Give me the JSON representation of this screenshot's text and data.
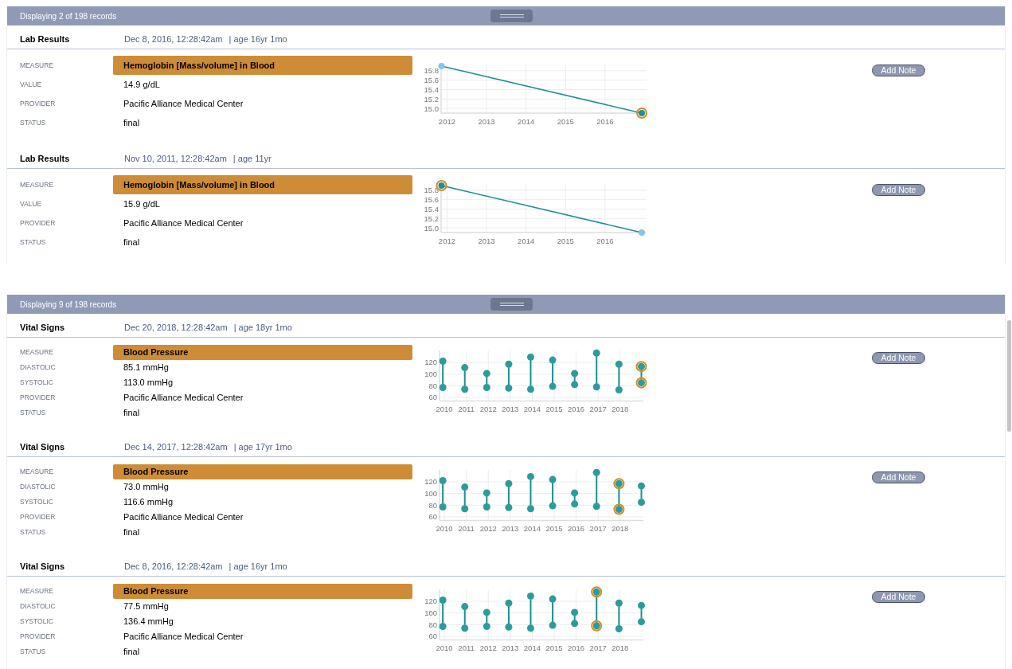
{
  "panels": [
    {
      "record_count": "Displaying 2 of 198 records",
      "records": [
        {
          "category": "Lab Results",
          "date": "Dec 8, 2016, 12:28:42am",
          "age": "| age 16yr 1mo",
          "fields": [
            {
              "kind": "measure",
              "label": "MEASURE",
              "value": "Hemoglobin [Mass/volume] in Blood"
            },
            {
              "kind": "plain",
              "label": "VALUE",
              "value": "14.9 g/dL"
            },
            {
              "kind": "plain",
              "label": "PROVIDER",
              "value": "Pacific Alliance Medical Center"
            },
            {
              "kind": "plain",
              "label": "STATUS",
              "value": "final"
            }
          ],
          "button": "Add Note",
          "chart_data": {
            "type": "line",
            "x": [
              2011.86,
              2016.93
            ],
            "series": [
              {
                "color": "#1f8f95",
                "values": [
                  15.9,
                  14.9
                ]
              },
              {
                "color": "#d98a1e",
                "values": [
                  null,
                  14.9
                ]
              }
            ],
            "marker": "circle",
            "grid": true,
            "xlim": [
              2011.85,
              2017.05
            ],
            "ylim": [
              14.9,
              15.95
            ],
            "xticks": [
              2012,
              2013,
              2014,
              2015,
              2016
            ],
            "yticks": [
              {
                "value": 15,
                "label": "15.0"
              },
              {
                "value": 15.2,
                "label": "15.2"
              },
              {
                "value": 15.4,
                "label": "15.4"
              },
              {
                "value": 15.6,
                "label": "15.6"
              },
              {
                "value": 15.8,
                "label": "15.8"
              }
            ]
          }
        },
        {
          "category": "Lab Results",
          "date": "Nov 10, 2011, 12:28:42am",
          "age": "| age 11yr",
          "fields": [
            {
              "kind": "measure",
              "label": "MEASURE",
              "value": "Hemoglobin [Mass/volume] in Blood"
            },
            {
              "kind": "plain",
              "label": "VALUE",
              "value": "15.9 g/dL"
            },
            {
              "kind": "plain",
              "label": "PROVIDER",
              "value": "Pacific Alliance Medical Center"
            },
            {
              "kind": "plain",
              "label": "STATUS",
              "value": "final"
            }
          ],
          "button": "Add Note",
          "chart_data": {
            "type": "line",
            "x": [
              2011.86,
              2016.93
            ],
            "series": [
              {
                "color": "#1f8f95",
                "values": [
                  15.9,
                  14.9
                ]
              },
              {
                "color": "#d98a1e",
                "values": [
                  15.9,
                  null
                ]
              }
            ],
            "marker": "circle",
            "grid": true,
            "xlim": [
              2011.85,
              2017.05
            ],
            "ylim": [
              14.9,
              15.95
            ],
            "xticks": [
              2012,
              2013,
              2014,
              2015,
              2016
            ],
            "yticks": [
              {
                "value": 15,
                "label": "15.0"
              },
              {
                "value": 15.2,
                "label": "15.2"
              },
              {
                "value": 15.4,
                "label": "15.4"
              },
              {
                "value": 15.6,
                "label": "15.6"
              },
              {
                "value": 15.8,
                "label": "15.8"
              }
            ]
          }
        }
      ]
    },
    {
      "record_count": "Displaying 9 of 198 records",
      "records": [
        {
          "category": "Vital Signs",
          "date": "Dec 20, 2018, 12:28:42am",
          "age": "| age 18yr 1mo",
          "fields": [
            {
              "kind": "measure",
              "label": "MEASURE",
              "value": "Blood Pressure"
            },
            {
              "kind": "plain",
              "label": "DIASTOLIC",
              "value": "85.1 mmHg"
            },
            {
              "kind": "plain",
              "label": "SYSTOLIC",
              "value": "113.0 mmHg"
            },
            {
              "kind": "plain",
              "label": "PROVIDER",
              "value": "Pacific Alliance Medical Center"
            },
            {
              "kind": "plain",
              "label": "STATUS",
              "value": "final"
            }
          ],
          "button": "Add Note",
          "chart_data": {
            "type": "scatter",
            "x": [
              2009.93,
              2010.93,
              2011.93,
              2012.93,
              2013.93,
              2014.93,
              2015.93,
              2016.93,
              2017.95,
              2018.97
            ],
            "series": [
              {
                "color": "#2a9d9a",
                "values": [
                  122,
                  111,
                  101,
                  117,
                  129,
                  124,
                  101,
                  136,
                  117,
                  113
                ]
              },
              {
                "color": "#2a9d9a",
                "values": [
                  77,
                  74,
                  77,
                  76,
                  74,
                  79,
                  82,
                  78,
                  73,
                  85
                ]
              },
              {
                "color": "#d98a1e",
                "values": [
                  null,
                  null,
                  null,
                  null,
                  null,
                  null,
                  null,
                  null,
                  null,
                  113
                ]
              },
              {
                "color": "#d98a1e",
                "values": [
                  null,
                  null,
                  null,
                  null,
                  null,
                  null,
                  null,
                  null,
                  null,
                  85
                ]
              }
            ],
            "grid": true,
            "xlim": [
              2009.78,
              2019.06
            ],
            "ylim": [
              54,
              140
            ],
            "xticks": [
              2010,
              2011,
              2012,
              2013,
              2014,
              2015,
              2016,
              2017,
              2018
            ],
            "yticks": [
              60,
              80,
              100,
              120
            ]
          }
        },
        {
          "category": "Vital Signs",
          "date": "Dec 14, 2017, 12:28:42am",
          "age": "| age 17yr 1mo",
          "fields": [
            {
              "kind": "measure",
              "label": "MEASURE",
              "value": "Blood Pressure"
            },
            {
              "kind": "plain",
              "label": "DIASTOLIC",
              "value": "73.0 mmHg"
            },
            {
              "kind": "plain",
              "label": "SYSTOLIC",
              "value": "116.6 mmHg"
            },
            {
              "kind": "plain",
              "label": "PROVIDER",
              "value": "Pacific Alliance Medical Center"
            },
            {
              "kind": "plain",
              "label": "STATUS",
              "value": "final"
            }
          ],
          "button": "Add Note",
          "chart_data": {
            "type": "scatter",
            "x": [
              2009.93,
              2010.93,
              2011.93,
              2012.93,
              2013.93,
              2014.93,
              2015.93,
              2016.93,
              2017.95,
              2018.97
            ],
            "series": [
              {
                "color": "#2a9d9a",
                "values": [
                  122,
                  111,
                  101,
                  117,
                  129,
                  124,
                  101,
                  136,
                  117,
                  113
                ]
              },
              {
                "color": "#2a9d9a",
                "values": [
                  77,
                  74,
                  77,
                  76,
                  74,
                  79,
                  82,
                  78,
                  73,
                  85
                ]
              },
              {
                "color": "#d98a1e",
                "values": [
                  null,
                  null,
                  null,
                  null,
                  null,
                  null,
                  null,
                  null,
                  117,
                  null
                ]
              },
              {
                "color": "#d98a1e",
                "values": [
                  null,
                  null,
                  null,
                  null,
                  null,
                  null,
                  null,
                  null,
                  73,
                  null
                ]
              }
            ],
            "grid": true,
            "xlim": [
              2009.78,
              2019.06
            ],
            "ylim": [
              54,
              140
            ],
            "xticks": [
              2010,
              2011,
              2012,
              2013,
              2014,
              2015,
              2016,
              2017,
              2018
            ],
            "yticks": [
              60,
              80,
              100,
              120
            ]
          }
        },
        {
          "category": "Vital Signs",
          "date": "Dec 8, 2016, 12:28:42am",
          "age": "| age 16yr 1mo",
          "fields": [
            {
              "kind": "measure",
              "label": "MEASURE",
              "value": "Blood Pressure"
            },
            {
              "kind": "plain",
              "label": "DIASTOLIC",
              "value": "77.5 mmHg"
            },
            {
              "kind": "plain",
              "label": "SYSTOLIC",
              "value": "136.4 mmHg"
            },
            {
              "kind": "plain",
              "label": "PROVIDER",
              "value": "Pacific Alliance Medical Center"
            },
            {
              "kind": "plain",
              "label": "STATUS",
              "value": "final"
            }
          ],
          "button": "Add Note",
          "chart_data": {
            "type": "scatter",
            "x": [
              2009.93,
              2010.93,
              2011.93,
              2012.93,
              2013.93,
              2014.93,
              2015.93,
              2016.93,
              2017.95,
              2018.97
            ],
            "series": [
              {
                "color": "#2a9d9a",
                "values": [
                  122,
                  111,
                  101,
                  117,
                  129,
                  124,
                  101,
                  136,
                  117,
                  113
                ]
              },
              {
                "color": "#2a9d9a",
                "values": [
                  77,
                  74,
                  77,
                  76,
                  74,
                  79,
                  82,
                  78,
                  73,
                  85
                ]
              },
              {
                "color": "#d98a1e",
                "values": [
                  null,
                  null,
                  null,
                  null,
                  null,
                  null,
                  null,
                  136,
                  null,
                  null
                ]
              },
              {
                "color": "#d98a1e",
                "values": [
                  null,
                  null,
                  null,
                  null,
                  null,
                  null,
                  null,
                  78,
                  null,
                  null
                ]
              }
            ],
            "grid": true,
            "xlim": [
              2009.78,
              2019.06
            ],
            "ylim": [
              54,
              140
            ],
            "xticks": [
              2010,
              2011,
              2012,
              2013,
              2014,
              2015,
              2016,
              2017,
              2018
            ],
            "yticks": [
              60,
              80,
              100,
              120
            ]
          }
        }
      ]
    }
  ]
}
